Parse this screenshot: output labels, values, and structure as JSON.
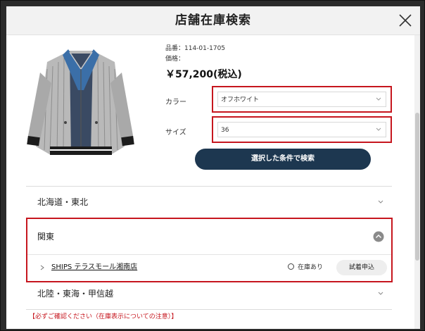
{
  "modal": {
    "title": "店舗在庫検索"
  },
  "product": {
    "code_line": "品番：114-01-1705",
    "price_label": "価格：",
    "price": "￥57,200(税込)"
  },
  "filters": {
    "color_label": "カラー",
    "color_value": "オフホワイト",
    "size_label": "サイズ",
    "size_value": "36",
    "search_button": "選択した条件で検索"
  },
  "regions": [
    {
      "label": "北海道・東北",
      "expanded": false
    },
    {
      "label": "関東",
      "expanded": true,
      "stores": [
        {
          "name": "SHIPS テラスモール湘南店",
          "stock": "在庫あり",
          "action": "試着申込"
        }
      ]
    },
    {
      "label": "北陸・東海・甲信越",
      "expanded": false
    }
  ],
  "notice": "【必ずご確認ください（在庫表示についての注意）】",
  "colors": {
    "accent": "#1d3750",
    "highlight": "#c6161e",
    "header_bg": "#f2f2f2"
  }
}
